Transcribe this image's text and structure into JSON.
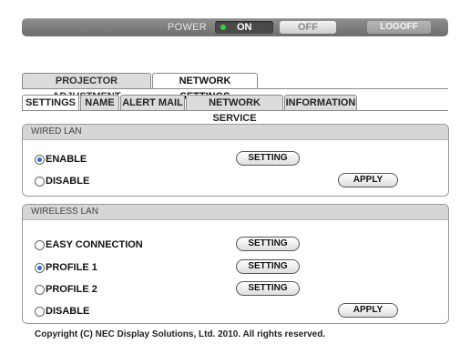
{
  "power": {
    "label": "POWER",
    "on_label": "ON",
    "off_label": "OFF",
    "logoff_label": "LOGOFF",
    "state": "on"
  },
  "main_tabs": [
    {
      "label": "PROJECTOR ADJUSTMENT",
      "active": false
    },
    {
      "label": "NETWORK SETTINGS",
      "active": true
    }
  ],
  "sub_tabs": [
    {
      "label": "SETTINGS",
      "active": true
    },
    {
      "label": "NAME",
      "active": false
    },
    {
      "label": "ALERT MAIL",
      "active": false
    },
    {
      "label": "NETWORK SERVICE",
      "active": false
    },
    {
      "label": "INFORMATION",
      "active": false
    }
  ],
  "wired_lan": {
    "title": "WIRED LAN",
    "options": [
      {
        "label": "ENABLE",
        "selected": true
      },
      {
        "label": "DISABLE",
        "selected": false
      }
    ],
    "setting_label": "SETTING",
    "apply_label": "APPLY"
  },
  "wireless_lan": {
    "title": "WIRELESS LAN",
    "options": [
      {
        "label": "EASY CONNECTION",
        "selected": false
      },
      {
        "label": "PROFILE 1",
        "selected": true
      },
      {
        "label": "PROFILE 2",
        "selected": false
      },
      {
        "label": "DISABLE",
        "selected": false
      }
    ],
    "setting_label": "SETTING",
    "apply_label": "APPLY"
  },
  "footer": {
    "copyright": "Copyright (C) NEC Display Solutions, Ltd. 2010. All rights reserved."
  },
  "colors": {
    "power_on_indicator": "#32d23a",
    "radio_selected": "#2d6fd1"
  }
}
